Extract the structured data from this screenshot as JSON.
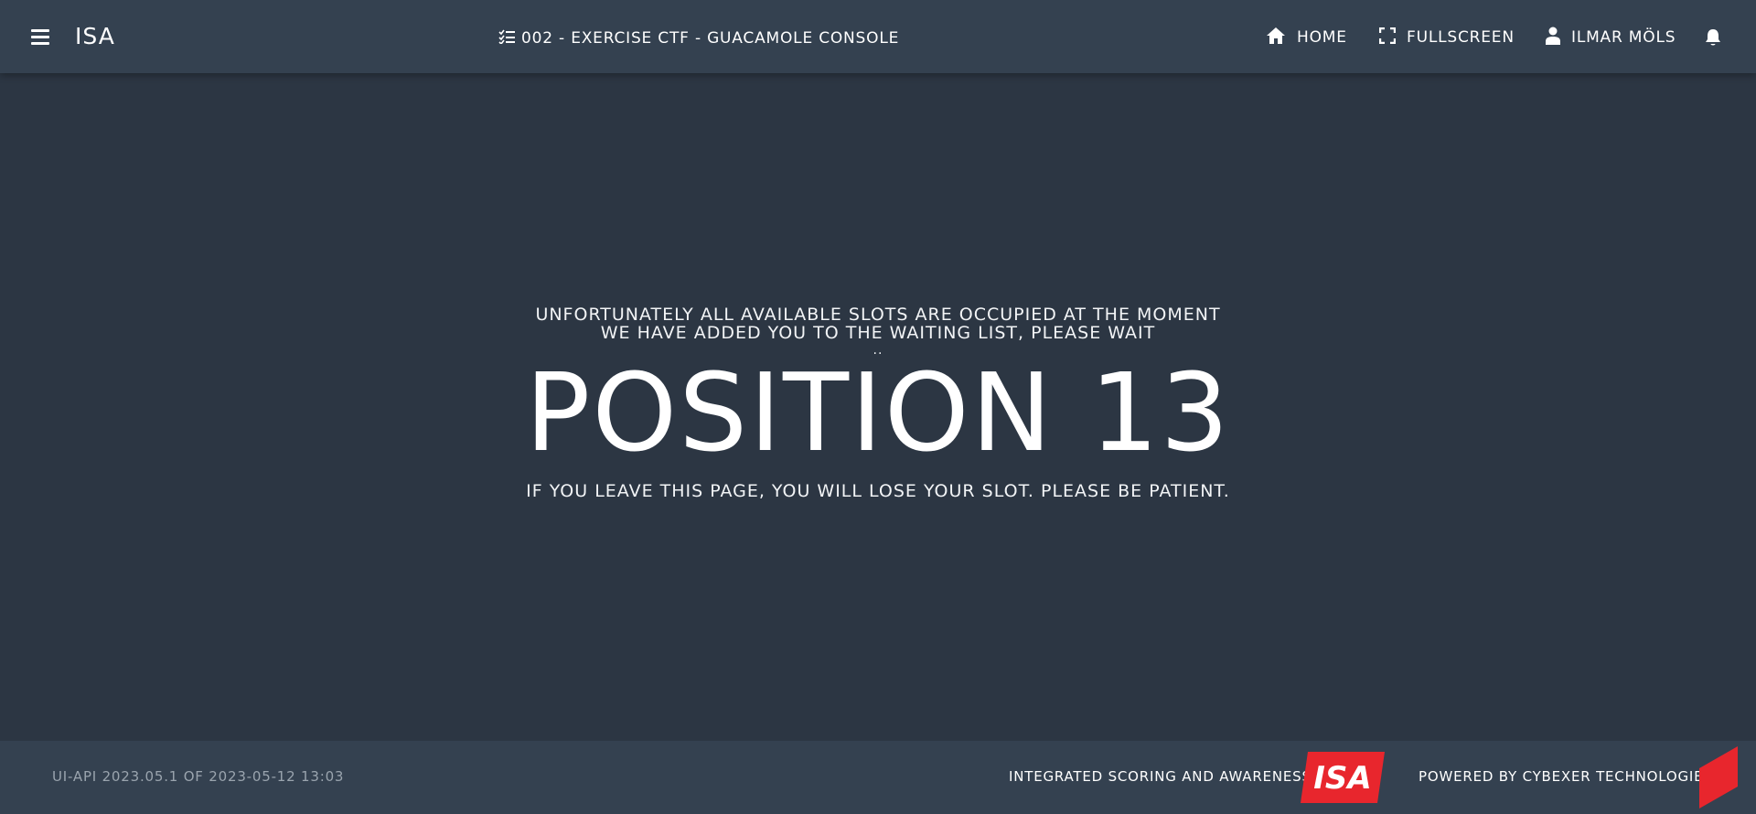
{
  "header": {
    "brand": "ISA",
    "page_title": "002 - EXERCISE CTF - GUACAMOLE CONSOLE",
    "nav": {
      "home": "HOME",
      "fullscreen": "FULLSCREEN",
      "user": "ILMAR MÖLS"
    },
    "icons": {
      "menu": "hamburger-menu-icon",
      "title": "checklist-icon",
      "home": "home-icon",
      "fullscreen": "fullscreen-icon",
      "user": "person-icon",
      "notifications": "bell-icon"
    }
  },
  "waiting": {
    "line1": "UNFORTUNATELY ALL AVAILABLE SLOTS ARE OCCUPIED AT THE MOMENT",
    "line2": "WE HAVE ADDED YOU TO THE WAITING LIST, PLEASE WAIT",
    "dots": "..",
    "position_label": "POSITION",
    "position_value": "13",
    "warning": "IF YOU LEAVE THIS PAGE, YOU WILL LOSE YOUR SLOT. PLEASE BE PATIENT."
  },
  "footer": {
    "version": "UI-API 2023.05.1 OF 2023-05-12 13:03",
    "isa_label": "INTEGRATED SCORING AND AWARENESS",
    "isa_logo_text": "ISA",
    "powered_by": "POWERED BY CYBEXER TECHNOLOGIES",
    "cybexer_logo_text": "CYBEXER TECHNOLOGIES"
  },
  "colors": {
    "background": "#2c3643",
    "bars": "#344150",
    "accent_red": "#e8262d",
    "muted_text": "#9aa4ae"
  }
}
